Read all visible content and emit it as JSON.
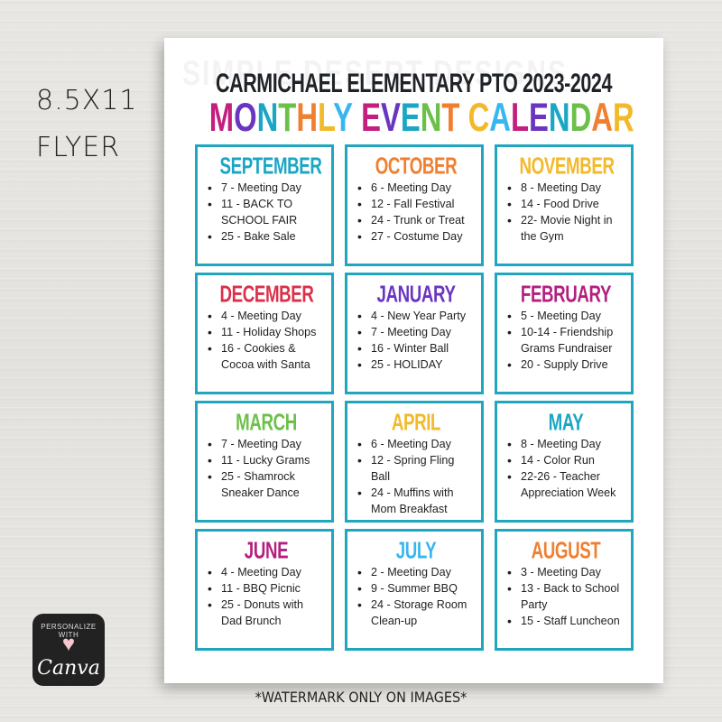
{
  "side_label": {
    "line1": "8.5X11",
    "line2": "FLYER"
  },
  "flyer": {
    "watermark_text": "SIMPLE DESERT DESIGNS",
    "title_top": "CARMICHAEL ELEMENTARY PTO 2023-2024",
    "title_main_letters": [
      {
        "ch": "M",
        "color": "#c21f7f"
      },
      {
        "ch": "O",
        "color": "#6a35c0"
      },
      {
        "ch": "N",
        "color": "#1aa6c4"
      },
      {
        "ch": "T",
        "color": "#6cc04a"
      },
      {
        "ch": "H",
        "color": "#f07f30"
      },
      {
        "ch": "L",
        "color": "#f2b92a"
      },
      {
        "ch": "Y",
        "color": "#38b6f0"
      },
      {
        "ch": " ",
        "color": "#000000"
      },
      {
        "ch": "E",
        "color": "#c21f7f"
      },
      {
        "ch": "V",
        "color": "#6a35c0"
      },
      {
        "ch": "E",
        "color": "#1aa6c4"
      },
      {
        "ch": "N",
        "color": "#6cc04a"
      },
      {
        "ch": "T",
        "color": "#f07f30"
      },
      {
        "ch": " ",
        "color": "#000000"
      },
      {
        "ch": "C",
        "color": "#f2b92a"
      },
      {
        "ch": "A",
        "color": "#38b6f0"
      },
      {
        "ch": "L",
        "color": "#c21f7f"
      },
      {
        "ch": "E",
        "color": "#6a35c0"
      },
      {
        "ch": "N",
        "color": "#1aa6c4"
      },
      {
        "ch": "D",
        "color": "#6cc04a"
      },
      {
        "ch": "A",
        "color": "#f07f30"
      },
      {
        "ch": "R",
        "color": "#f2b92a"
      }
    ],
    "box_border_color": "#21a6c0",
    "months": [
      {
        "name": "SEPTEMBER",
        "color": "#1aa6c4",
        "events": [
          "7 - Meeting Day",
          "11 - BACK TO SCHOOL FAIR",
          "25 - Bake Sale"
        ]
      },
      {
        "name": "OCTOBER",
        "color": "#f07f30",
        "events": [
          "6 - Meeting Day",
          "12 - Fall Festival",
          "24 - Trunk or Treat",
          "27 - Costume Day"
        ]
      },
      {
        "name": "NOVEMBER",
        "color": "#f2b92a",
        "events": [
          "8 - Meeting Day",
          "14 - Food Drive",
          "22- Movie Night in the Gym"
        ]
      },
      {
        "name": "DECEMBER",
        "color": "#dc2f4b",
        "events": [
          "4 - Meeting Day",
          "11 - Holiday Shops",
          "16 - Cookies & Cocoa with Santa"
        ]
      },
      {
        "name": "JANUARY",
        "color": "#6a35c0",
        "events": [
          "4 - New Year Party",
          "7 - Meeting Day",
          "16 - Winter Ball",
          "25 - HOLIDAY"
        ]
      },
      {
        "name": "FEBRUARY",
        "color": "#b41f7e",
        "events": [
          "5 - Meeting Day",
          "10-14 - Friendship Grams Fundraiser",
          "20 - Supply Drive"
        ]
      },
      {
        "name": "MARCH",
        "color": "#6cc04a",
        "events": [
          "7 - Meeting Day",
          "11 - Lucky Grams",
          "25 - Shamrock Sneaker Dance"
        ]
      },
      {
        "name": "APRIL",
        "color": "#f2b92a",
        "events": [
          "6 - Meeting Day",
          "12 - Spring Fling Ball",
          "24 - Muffins with Mom Breakfast"
        ]
      },
      {
        "name": "MAY",
        "color": "#1aa6c4",
        "events": [
          "8 - Meeting Day",
          "14 - Color Run",
          "22-26 - Teacher Appreciation Week"
        ]
      },
      {
        "name": "JUNE",
        "color": "#b41f7e",
        "events": [
          "4 - Meeting Day",
          "11 - BBQ Picnic",
          "25 - Donuts with Dad Brunch"
        ]
      },
      {
        "name": "JULY",
        "color": "#38b6f0",
        "events": [
          "2 - Meeting Day",
          "9 - Summer BBQ",
          "24 - Storage Room Clean-up"
        ]
      },
      {
        "name": "AUGUST",
        "color": "#f07f30",
        "events": [
          "3 - Meeting Day",
          "13 - Back to School Party",
          "15 - Staff Luncheon"
        ]
      }
    ]
  },
  "canva_badge": {
    "top_text": "PERSONALIZE WITH",
    "heart_icon": "heart",
    "brand": "Canva"
  },
  "footer_note": "*WATERMARK ONLY ON IMAGES*"
}
